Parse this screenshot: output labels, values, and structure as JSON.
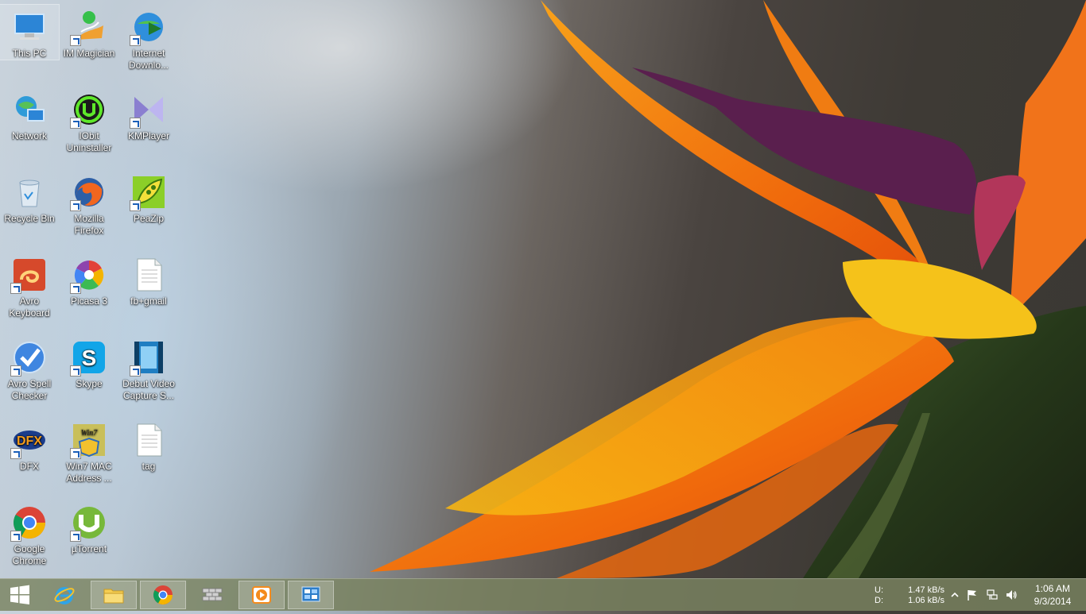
{
  "desktop_icons": [
    {
      "label": "This PC",
      "icon": "this-pc-icon"
    },
    {
      "label": "IM Magician",
      "icon": "im-magician-icon"
    },
    {
      "label": "Internet Downlo...",
      "icon": "internet-download-manager-icon"
    },
    {
      "label": "Network",
      "icon": "network-icon"
    },
    {
      "label": "IObit Uninstaller",
      "icon": "iobit-uninstaller-icon"
    },
    {
      "label": "KMPlayer",
      "icon": "kmplayer-icon"
    },
    {
      "label": "Recycle Bin",
      "icon": "recycle-bin-icon"
    },
    {
      "label": "Mozilla Firefox",
      "icon": "firefox-icon"
    },
    {
      "label": "PeaZip",
      "icon": "peazip-icon"
    },
    {
      "label": "Avro Keyboard",
      "icon": "avro-keyboard-icon"
    },
    {
      "label": "Picasa 3",
      "icon": "picasa-icon"
    },
    {
      "label": "fb+gmail",
      "icon": "text-file-icon"
    },
    {
      "label": "Avro Spell Checker",
      "icon": "avro-spell-checker-icon"
    },
    {
      "label": "Skype",
      "icon": "skype-icon"
    },
    {
      "label": "Debut Video Capture S...",
      "icon": "debut-video-capture-icon"
    },
    {
      "label": "DFX",
      "icon": "dfx-icon"
    },
    {
      "label": "Win7 MAC Address ...",
      "icon": "win7-mac-address-icon"
    },
    {
      "label": "tag",
      "icon": "text-file-icon"
    },
    {
      "label": "Google Chrome",
      "icon": "chrome-icon"
    },
    {
      "label": "µTorrent",
      "icon": "utorrent-icon"
    }
  ],
  "taskbar": {
    "buttons": [
      {
        "name": "start-button",
        "icon": "windows-logo-icon"
      },
      {
        "name": "internet-explorer-button",
        "icon": "internet-explorer-icon"
      },
      {
        "name": "file-explorer-button",
        "icon": "folder-icon"
      },
      {
        "name": "chrome-taskbar-button",
        "icon": "chrome-icon"
      },
      {
        "name": "firewall-taskbar-button",
        "icon": "brick-wall-icon"
      },
      {
        "name": "media-player-taskbar-button",
        "icon": "media-player-icon"
      },
      {
        "name": "control-panel-taskbar-button",
        "icon": "control-panel-icon"
      }
    ],
    "netspeed": {
      "up_label": "U:",
      "up_value": "1.47 kB/s",
      "down_label": "D:",
      "down_value": "1.06 kB/s"
    },
    "clock": {
      "time": "1:06 AM",
      "date": "9/3/2014"
    }
  },
  "colors": {
    "taskbar": "#7a8460",
    "flower_orange": "#f07a10",
    "flower_yellow": "#f5c21a",
    "flower_purple": "#5a1f4e"
  }
}
